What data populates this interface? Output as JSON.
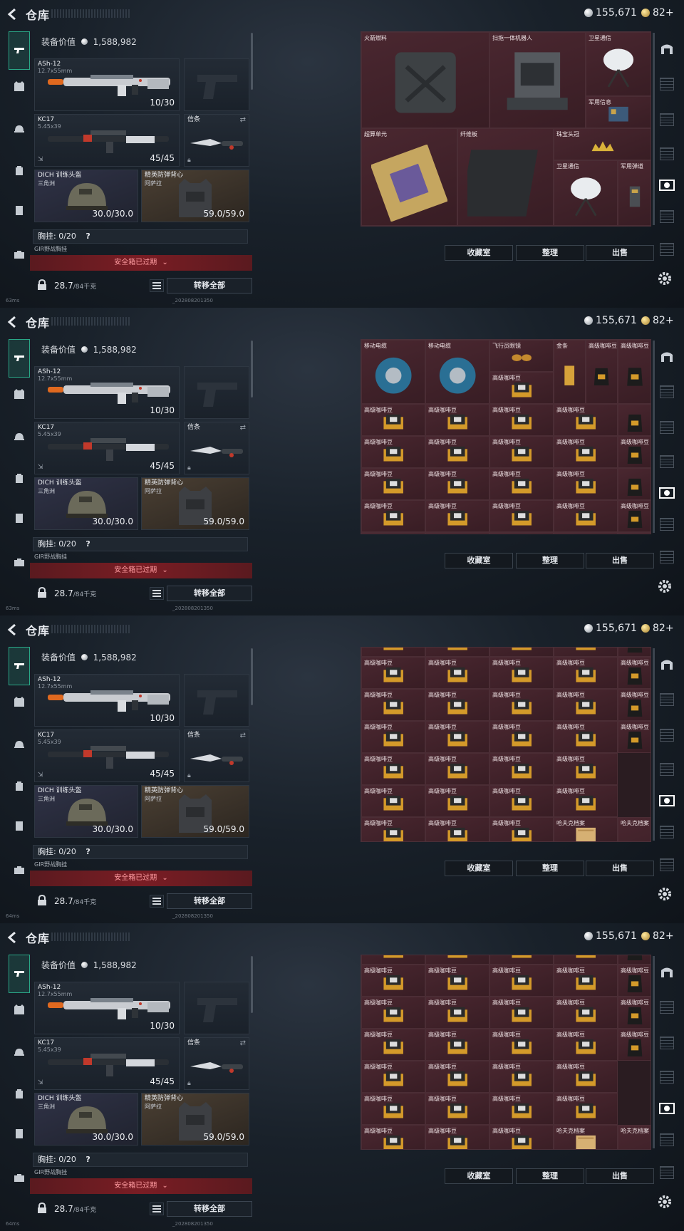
{
  "header": {
    "title": "仓库",
    "silver": "155,671",
    "gold": "82+"
  },
  "equipment": {
    "value_label": "装备价值",
    "value": "1,588,982",
    "primary": {
      "name": "ASh-12",
      "caliber": "12.7x55mm",
      "ammo": "10/30"
    },
    "secondary": {
      "name": "KC17",
      "caliber": "5.45x39",
      "ammo": "45/45"
    },
    "melee": {
      "name": "信条"
    },
    "helmet": {
      "name": "DICH 训练头盔",
      "sub": "三角洲",
      "durability": "30.0/30.0"
    },
    "armor": {
      "name": "精英防弹背心",
      "sub": "阿萨拉",
      "durability": "59.0/59.0"
    },
    "chest_rig": {
      "label": "胸挂:",
      "capacity": "0/20",
      "help": "?"
    },
    "mini_label": "GIR野战胸挂",
    "safe_box": "安全箱已过期",
    "weight": "28.7",
    "weight_max": "/84千克",
    "transfer_all": "转移全部"
  },
  "stash": {
    "buttons": {
      "collection": "收藏室",
      "sort": "整理",
      "sell": "出售"
    },
    "panel1": [
      {
        "label": "火箭燃料",
        "kind": "jerrycan"
      },
      {
        "label": "扫拖一体机器人",
        "kind": "robot"
      },
      {
        "label": "卫星通信",
        "kind": "dish"
      },
      {
        "label": "军用信息",
        "kind": "board"
      },
      {
        "label": "超算单元",
        "kind": "gpu"
      },
      {
        "label": "纤维板",
        "kind": "fiber"
      },
      {
        "label": "珠宝头冠",
        "kind": "crown"
      },
      {
        "label": "卫星通信",
        "kind": "dish"
      },
      {
        "label": "军用弹道",
        "kind": "device"
      }
    ],
    "panel2_top": [
      {
        "label": "移动电缆",
        "kind": "cable"
      },
      {
        "label": "移动电缆",
        "kind": "cable"
      },
      {
        "label": "飞行员眼镜",
        "kind": "glasses"
      },
      {
        "label": "金条",
        "kind": "gold"
      },
      {
        "label": "高级咖啡豆",
        "kind": "coffee"
      },
      {
        "label": "高级咖啡豆",
        "kind": "coffee"
      }
    ],
    "coffee_label": "高级咖啡豆",
    "coffee_box_label": "高级咖啡豆",
    "archive_label": "哈夫克档案"
  },
  "status": {
    "ping1": "63ms",
    "ping2": "63ms",
    "ping3": "64ms",
    "ping4": "64ms",
    "build": "_202808201350"
  },
  "colors": {
    "accent": "#2aa887",
    "danger": "#7a1d24",
    "stash_bg": "#381d24"
  }
}
